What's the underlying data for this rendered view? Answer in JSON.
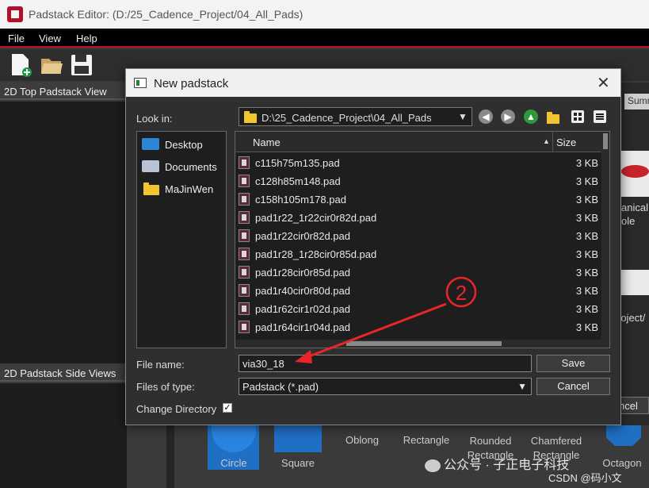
{
  "window": {
    "title": "Padstack Editor:   (D:/25_Cadence_Project/04_All_Pads)"
  },
  "menu": [
    "File",
    "View",
    "Help"
  ],
  "toolbar": {
    "icons": [
      "new-file-icon",
      "open-folder-icon",
      "save-icon"
    ]
  },
  "panels": {
    "top_view": "2D Top Padstack View",
    "side_views": "2D Padstack Side Views"
  },
  "background": {
    "summ_tab": "Summ",
    "mechanical_line1": "anical",
    "mechanical_line2": "ole",
    "path_fragment": "roject/",
    "cancel_fragment": "ncel",
    "shapes": [
      "Circle",
      "Square",
      "Oblong",
      "Rectangle",
      "Rounded Rectangle",
      "Chamfered Rectangle",
      "Octagon"
    ]
  },
  "dialog": {
    "title": "New padstack",
    "look_in_label": "Look in:",
    "look_in_value": "D:\\25_Cadence_Project\\04_All_Pads",
    "sidebar": [
      {
        "label": "Desktop",
        "icon": "desktop-icon"
      },
      {
        "label": "Documents",
        "icon": "documents-icon"
      },
      {
        "label": "MaJinWen",
        "icon": "folder-icon"
      }
    ],
    "columns": {
      "name": "Name",
      "size": "Size"
    },
    "files": [
      {
        "name": "c115h75m135.pad",
        "size": "3 KB"
      },
      {
        "name": "c128h85m148.pad",
        "size": "3 KB"
      },
      {
        "name": "c158h105m178.pad",
        "size": "3 KB"
      },
      {
        "name": "pad1r22_1r22cir0r82d.pad",
        "size": "3 KB"
      },
      {
        "name": "pad1r22cir0r82d.pad",
        "size": "3 KB"
      },
      {
        "name": "pad1r28_1r28cir0r85d.pad",
        "size": "3 KB"
      },
      {
        "name": "pad1r28cir0r85d.pad",
        "size": "3 KB"
      },
      {
        "name": "pad1r40cir0r80d.pad",
        "size": "3 KB"
      },
      {
        "name": "pad1r62cir1r02d.pad",
        "size": "3 KB"
      },
      {
        "name": "pad1r64cir1r04d.pad",
        "size": "3 KB"
      }
    ],
    "file_name_label": "File name:",
    "file_name_value": "via30_18",
    "files_of_type_label": "Files of type:",
    "files_of_type_value": "Padstack (*.pad)",
    "save_label": "Save",
    "cancel_label": "Cancel",
    "change_directory_label": "Change Directory",
    "change_directory_checked": true
  },
  "annotation": {
    "marker": "2",
    "color": "#e8262a"
  },
  "watermark": {
    "line1": "公众号 · 子正电子科技",
    "line2": "CSDN @码小文"
  },
  "colors": {
    "accent_red": "#c0102a",
    "selected_shape": "#1f6fc4"
  }
}
